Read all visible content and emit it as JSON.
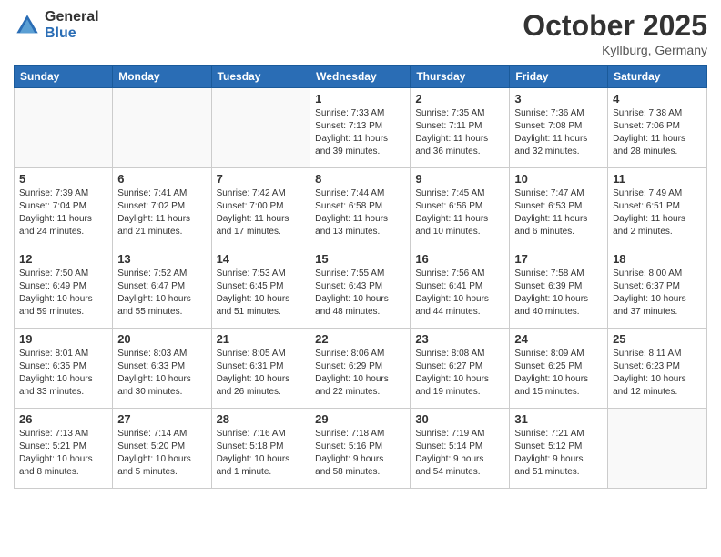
{
  "header": {
    "logo_general": "General",
    "logo_blue": "Blue",
    "month_title": "October 2025",
    "location": "Kyllburg, Germany"
  },
  "weekdays": [
    "Sunday",
    "Monday",
    "Tuesday",
    "Wednesday",
    "Thursday",
    "Friday",
    "Saturday"
  ],
  "weeks": [
    [
      {
        "day": "",
        "info": ""
      },
      {
        "day": "",
        "info": ""
      },
      {
        "day": "",
        "info": ""
      },
      {
        "day": "1",
        "info": "Sunrise: 7:33 AM\nSunset: 7:13 PM\nDaylight: 11 hours\nand 39 minutes."
      },
      {
        "day": "2",
        "info": "Sunrise: 7:35 AM\nSunset: 7:11 PM\nDaylight: 11 hours\nand 36 minutes."
      },
      {
        "day": "3",
        "info": "Sunrise: 7:36 AM\nSunset: 7:08 PM\nDaylight: 11 hours\nand 32 minutes."
      },
      {
        "day": "4",
        "info": "Sunrise: 7:38 AM\nSunset: 7:06 PM\nDaylight: 11 hours\nand 28 minutes."
      }
    ],
    [
      {
        "day": "5",
        "info": "Sunrise: 7:39 AM\nSunset: 7:04 PM\nDaylight: 11 hours\nand 24 minutes."
      },
      {
        "day": "6",
        "info": "Sunrise: 7:41 AM\nSunset: 7:02 PM\nDaylight: 11 hours\nand 21 minutes."
      },
      {
        "day": "7",
        "info": "Sunrise: 7:42 AM\nSunset: 7:00 PM\nDaylight: 11 hours\nand 17 minutes."
      },
      {
        "day": "8",
        "info": "Sunrise: 7:44 AM\nSunset: 6:58 PM\nDaylight: 11 hours\nand 13 minutes."
      },
      {
        "day": "9",
        "info": "Sunrise: 7:45 AM\nSunset: 6:56 PM\nDaylight: 11 hours\nand 10 minutes."
      },
      {
        "day": "10",
        "info": "Sunrise: 7:47 AM\nSunset: 6:53 PM\nDaylight: 11 hours\nand 6 minutes."
      },
      {
        "day": "11",
        "info": "Sunrise: 7:49 AM\nSunset: 6:51 PM\nDaylight: 11 hours\nand 2 minutes."
      }
    ],
    [
      {
        "day": "12",
        "info": "Sunrise: 7:50 AM\nSunset: 6:49 PM\nDaylight: 10 hours\nand 59 minutes."
      },
      {
        "day": "13",
        "info": "Sunrise: 7:52 AM\nSunset: 6:47 PM\nDaylight: 10 hours\nand 55 minutes."
      },
      {
        "day": "14",
        "info": "Sunrise: 7:53 AM\nSunset: 6:45 PM\nDaylight: 10 hours\nand 51 minutes."
      },
      {
        "day": "15",
        "info": "Sunrise: 7:55 AM\nSunset: 6:43 PM\nDaylight: 10 hours\nand 48 minutes."
      },
      {
        "day": "16",
        "info": "Sunrise: 7:56 AM\nSunset: 6:41 PM\nDaylight: 10 hours\nand 44 minutes."
      },
      {
        "day": "17",
        "info": "Sunrise: 7:58 AM\nSunset: 6:39 PM\nDaylight: 10 hours\nand 40 minutes."
      },
      {
        "day": "18",
        "info": "Sunrise: 8:00 AM\nSunset: 6:37 PM\nDaylight: 10 hours\nand 37 minutes."
      }
    ],
    [
      {
        "day": "19",
        "info": "Sunrise: 8:01 AM\nSunset: 6:35 PM\nDaylight: 10 hours\nand 33 minutes."
      },
      {
        "day": "20",
        "info": "Sunrise: 8:03 AM\nSunset: 6:33 PM\nDaylight: 10 hours\nand 30 minutes."
      },
      {
        "day": "21",
        "info": "Sunrise: 8:05 AM\nSunset: 6:31 PM\nDaylight: 10 hours\nand 26 minutes."
      },
      {
        "day": "22",
        "info": "Sunrise: 8:06 AM\nSunset: 6:29 PM\nDaylight: 10 hours\nand 22 minutes."
      },
      {
        "day": "23",
        "info": "Sunrise: 8:08 AM\nSunset: 6:27 PM\nDaylight: 10 hours\nand 19 minutes."
      },
      {
        "day": "24",
        "info": "Sunrise: 8:09 AM\nSunset: 6:25 PM\nDaylight: 10 hours\nand 15 minutes."
      },
      {
        "day": "25",
        "info": "Sunrise: 8:11 AM\nSunset: 6:23 PM\nDaylight: 10 hours\nand 12 minutes."
      }
    ],
    [
      {
        "day": "26",
        "info": "Sunrise: 7:13 AM\nSunset: 5:21 PM\nDaylight: 10 hours\nand 8 minutes."
      },
      {
        "day": "27",
        "info": "Sunrise: 7:14 AM\nSunset: 5:20 PM\nDaylight: 10 hours\nand 5 minutes."
      },
      {
        "day": "28",
        "info": "Sunrise: 7:16 AM\nSunset: 5:18 PM\nDaylight: 10 hours\nand 1 minute."
      },
      {
        "day": "29",
        "info": "Sunrise: 7:18 AM\nSunset: 5:16 PM\nDaylight: 9 hours\nand 58 minutes."
      },
      {
        "day": "30",
        "info": "Sunrise: 7:19 AM\nSunset: 5:14 PM\nDaylight: 9 hours\nand 54 minutes."
      },
      {
        "day": "31",
        "info": "Sunrise: 7:21 AM\nSunset: 5:12 PM\nDaylight: 9 hours\nand 51 minutes."
      },
      {
        "day": "",
        "info": ""
      }
    ]
  ]
}
